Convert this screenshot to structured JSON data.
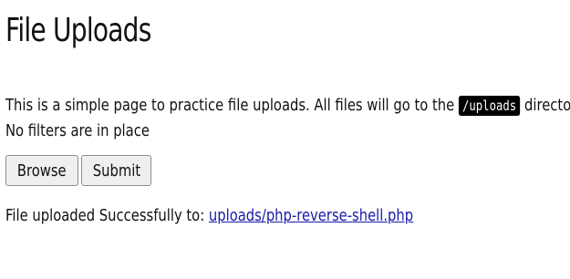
{
  "page": {
    "title": "File Uploads",
    "description_before_code": "This is a simple page to practice file uploads. All files will go to the ",
    "code_path": "/uploads",
    "description_after_code": " directory",
    "filters_note": "No filters are in place"
  },
  "form": {
    "browse_label": "Browse",
    "submit_label": "Submit"
  },
  "status": {
    "message": "File uploaded Successfully to: ",
    "link_text": "uploads/php-reverse-shell.php"
  }
}
